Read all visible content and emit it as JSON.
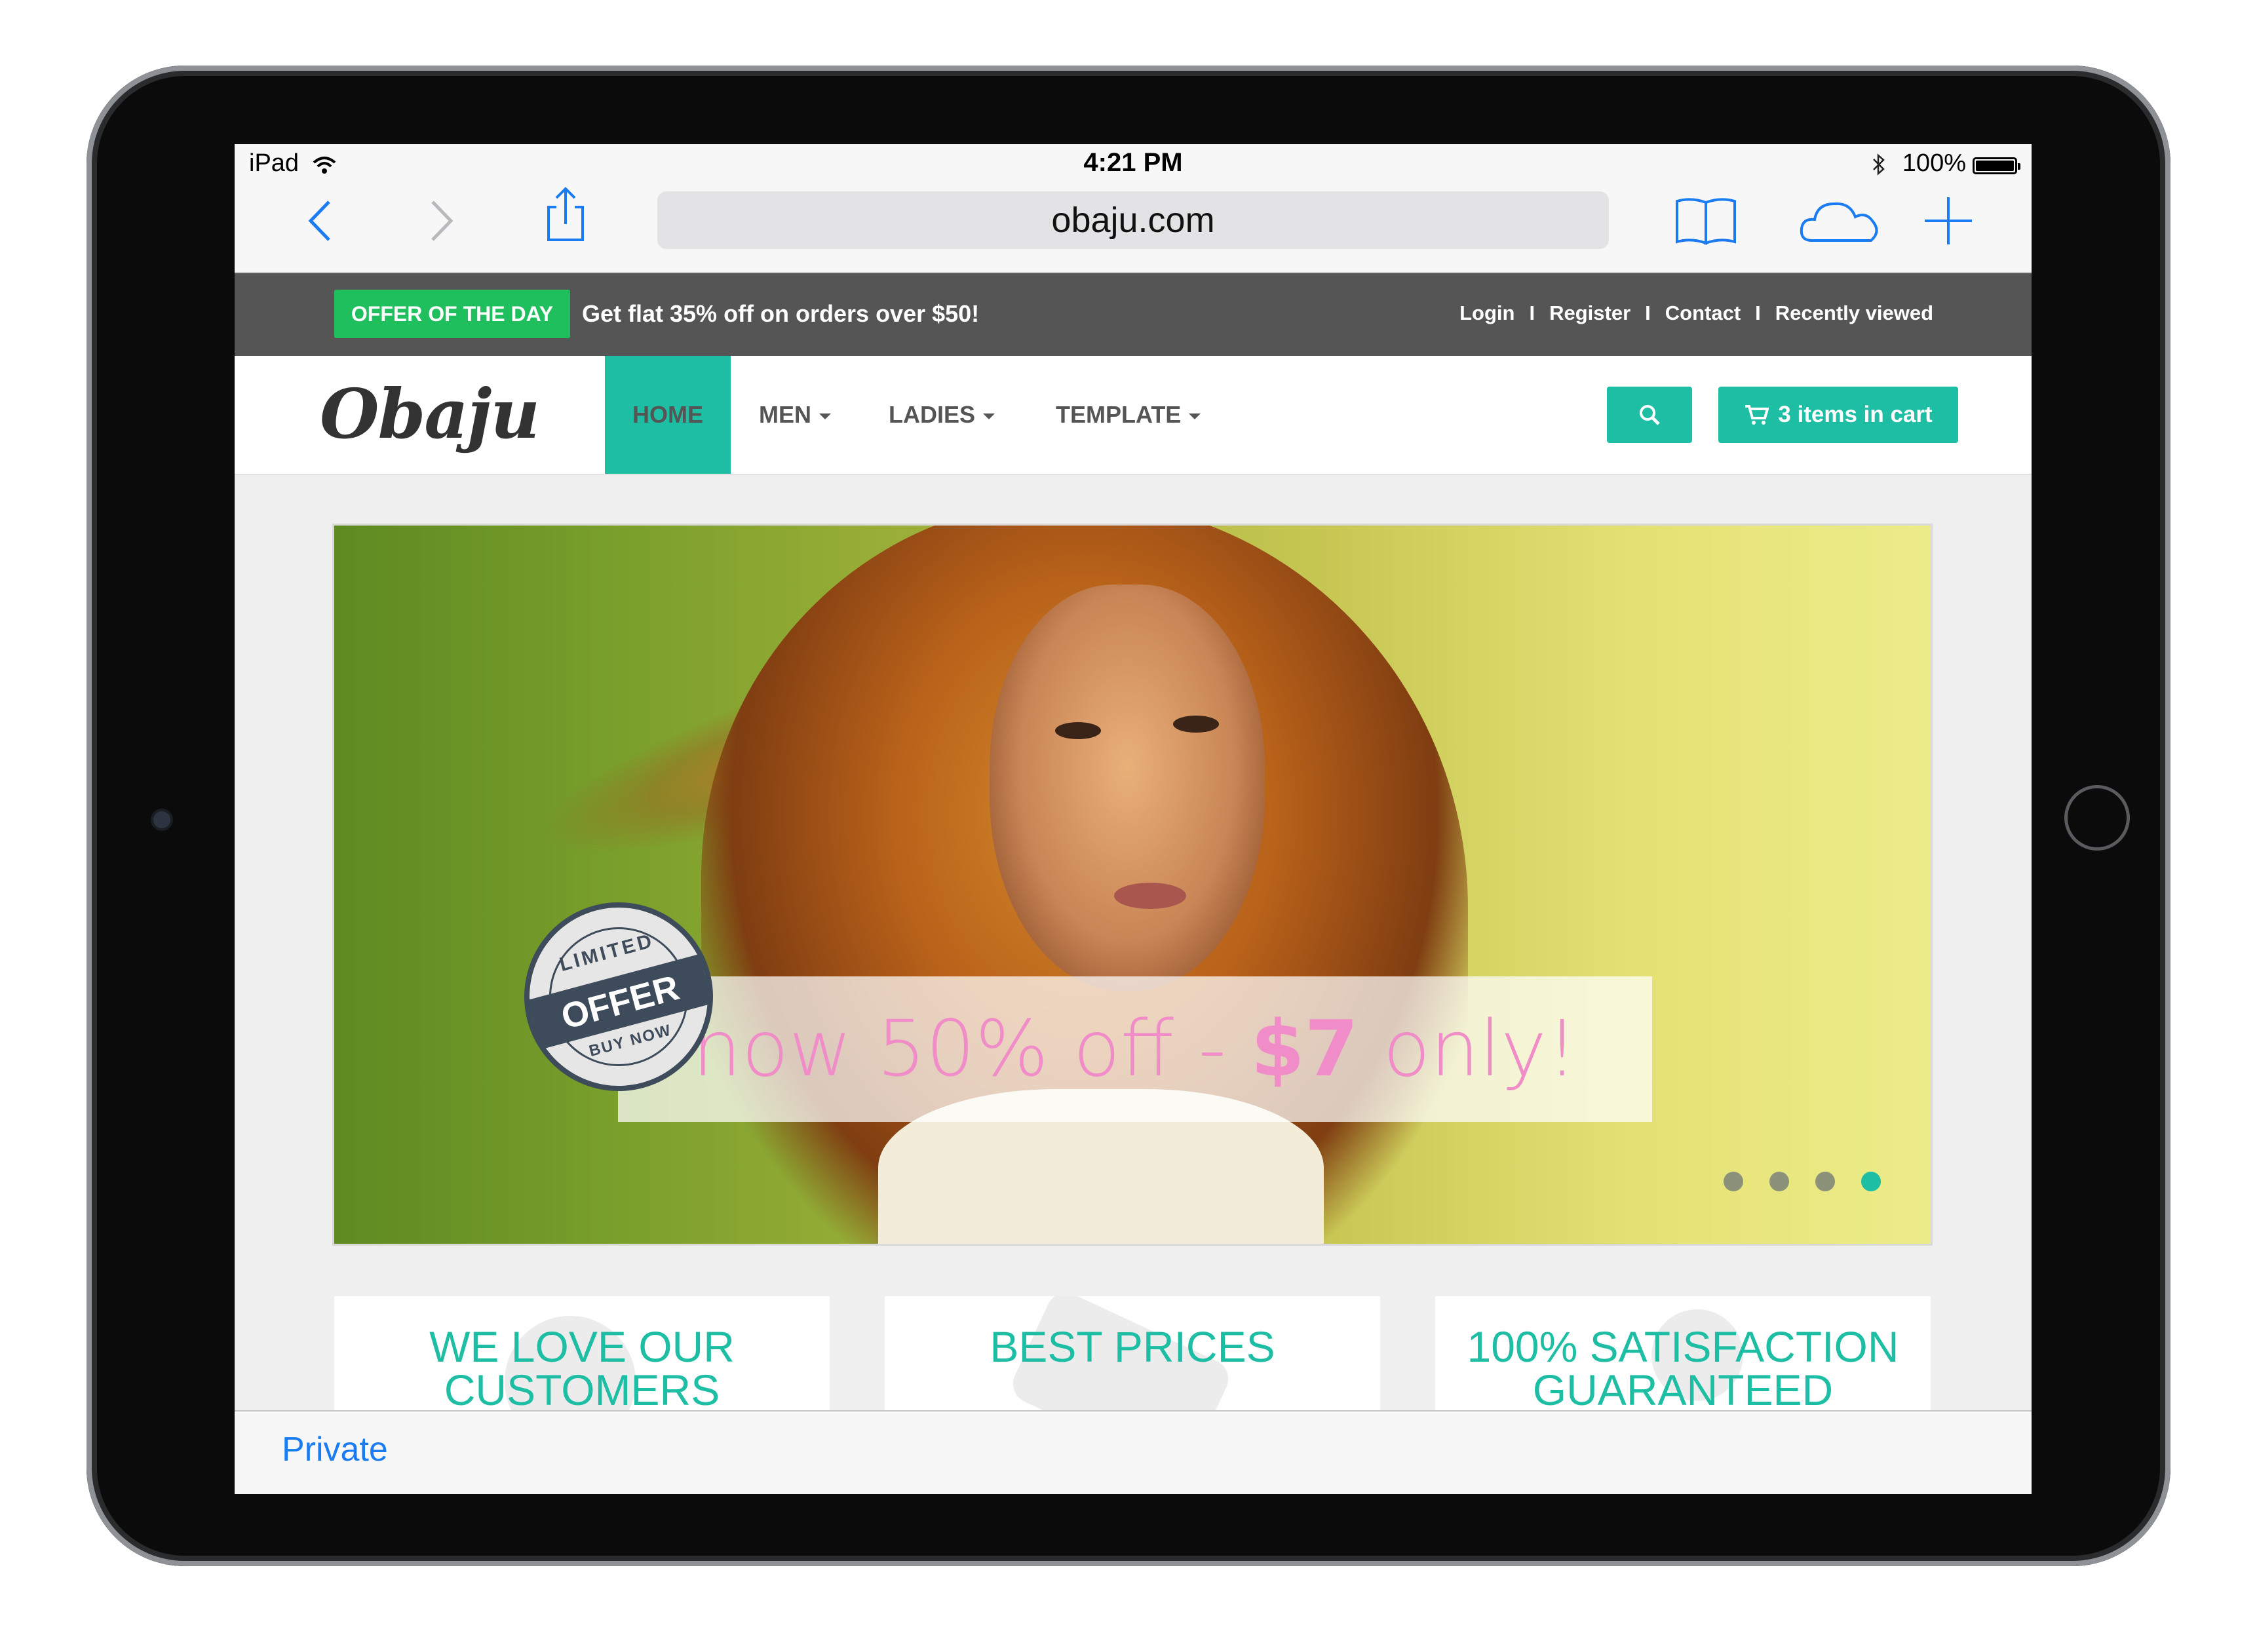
{
  "status_bar": {
    "carrier": "iPad",
    "time": "4:21 PM",
    "battery": "100%"
  },
  "browser": {
    "url": "obaju.com",
    "bottom_label": "Private",
    "icons": [
      "back-icon",
      "forward-icon",
      "share-icon",
      "bookmarks-icon",
      "cloud-tabs-icon",
      "new-tab-icon"
    ]
  },
  "topbar": {
    "offer_badge": "OFFER OF THE DAY",
    "offer_text": "Get flat 35% off on orders over $50!",
    "links": [
      "Login",
      "Register",
      "Contact",
      "Recently viewed"
    ],
    "separator": "I"
  },
  "nav": {
    "logo": "Obaju",
    "items": [
      "HOME",
      "MEN",
      "LADIES",
      "TEMPLATE"
    ],
    "active_item": "HOME",
    "cart_label": "3 items in cart",
    "accent_color": "#1ebea5"
  },
  "hero": {
    "promo_prefix": "now 50% off - ",
    "promo_price": "$7",
    "promo_suffix": " only!",
    "seal": {
      "top": "LIMITED",
      "main": "OFFER",
      "bottom": "BUY NOW"
    },
    "slide_count": 4,
    "active_slide": 4
  },
  "features": [
    {
      "line1": "WE LOVE OUR",
      "line2": "CUSTOMERS"
    },
    {
      "line1": "BEST PRICES",
      "line2": ""
    },
    {
      "line1": "100% SATISFACTION",
      "line2": "GUARANTEED"
    }
  ]
}
